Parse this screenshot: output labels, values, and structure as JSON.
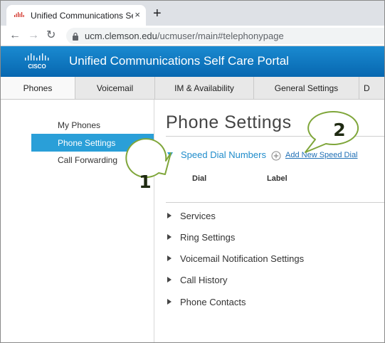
{
  "browser": {
    "tab_title": "Unified Communications Self Ca",
    "url_host": "ucm.clemson.edu",
    "url_path": "/ucmuser/main#telephonypage",
    "close_glyph": "×",
    "new_tab_glyph": "+",
    "back_glyph": "←",
    "forward_glyph": "→",
    "reload_glyph": "↻"
  },
  "banner": {
    "logo_text": "CISCO",
    "title": "Unified Communications Self Care Portal",
    "color": "#0b74c0"
  },
  "nav_tabs": [
    {
      "label": "Phones"
    },
    {
      "label": "Voicemail"
    },
    {
      "label": "IM & Availability"
    },
    {
      "label": "General Settings"
    },
    {
      "label": "D"
    }
  ],
  "sidebar": {
    "items": [
      {
        "label": "My Phones"
      },
      {
        "label": "Phone Settings"
      },
      {
        "label": "Call Forwarding"
      }
    ],
    "active_color": "#2a9fd8"
  },
  "main": {
    "title": "Phone Settings",
    "speed_dial": {
      "label": "Speed Dial Numbers",
      "add_link": "Add New Speed Dial",
      "columns": [
        "Dial",
        "Label"
      ]
    },
    "sections": [
      {
        "label": "Services"
      },
      {
        "label": "Ring Settings"
      },
      {
        "label": "Voicemail Notification Settings"
      },
      {
        "label": "Call History"
      },
      {
        "label": "Phone Contacts"
      }
    ]
  },
  "callouts": [
    {
      "number": "1"
    },
    {
      "number": "2"
    }
  ],
  "colors": {
    "callout_stroke": "#7fa63a",
    "link": "#1f8ccb"
  }
}
